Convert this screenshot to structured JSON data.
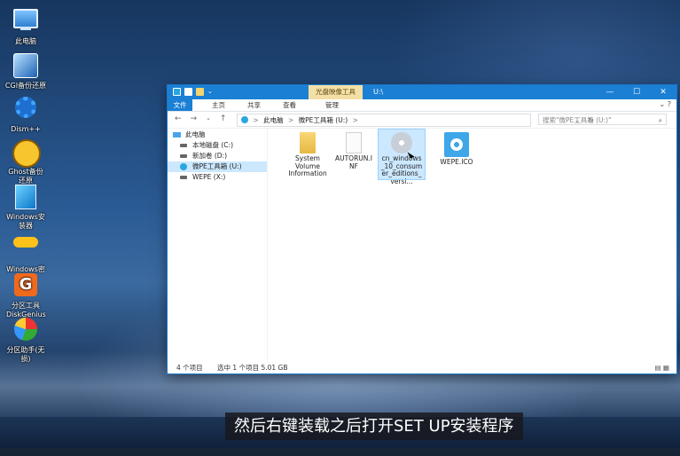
{
  "desktop": {
    "icons": [
      {
        "label": "此电脑",
        "icon": "computer-icon"
      },
      {
        "label": "CGI备份还原",
        "icon": "cgi-backup-icon"
      },
      {
        "label": "Dism++",
        "icon": "gear-icon"
      },
      {
        "label": "Ghost备份还原",
        "icon": "ghost-icon"
      },
      {
        "label": "Windows安装器",
        "icon": "windows-installer-icon"
      },
      {
        "label": "Windows密码修改",
        "icon": "key-icon"
      },
      {
        "label": "分区工具DiskGenius",
        "icon": "diskgenius-icon"
      },
      {
        "label": "分区助手(无损)",
        "icon": "partition-assistant-icon"
      }
    ]
  },
  "window": {
    "context_tab": "光盘映像工具",
    "title": "U:\\",
    "controls": {
      "minimize": "—",
      "maximize": "☐",
      "close": "✕"
    },
    "ribbon_tabs": [
      "文件",
      "主页",
      "共享",
      "查看",
      "管理"
    ],
    "address": {
      "back": "←",
      "forward": "→",
      "recent": "⌄",
      "up": "↑",
      "path": [
        "此电脑",
        "微PE工具箱 (U:)"
      ],
      "separator": ">",
      "dropdown": "⌄",
      "refresh": "↻"
    },
    "search_placeholder": "搜索\"微PE工具箱 (U:)\"",
    "nav_pane": [
      {
        "label": "此电脑",
        "icon": "computer-icon",
        "selected": false
      },
      {
        "label": "本地磁盘 (C:)",
        "icon": "drive-icon",
        "selected": false
      },
      {
        "label": "新加卷 (D:)",
        "icon": "drive-icon",
        "selected": false
      },
      {
        "label": "微PE工具箱 (U:)",
        "icon": "cd-drive-icon",
        "selected": true
      },
      {
        "label": "WEPE (X:)",
        "icon": "drive-icon",
        "selected": false
      }
    ],
    "files": [
      {
        "name": "System Volume Information",
        "icon": "folder-icon",
        "selected": false
      },
      {
        "name": "AUTORUN.INF",
        "icon": "document-icon",
        "selected": false
      },
      {
        "name": "cn_windows_10_consumer_editions_versi...",
        "icon": "disc-image-icon",
        "selected": true
      },
      {
        "name": "WEPE.ICO",
        "icon": "ico-file-icon",
        "selected": false
      }
    ],
    "status": {
      "count": "4 个项目",
      "selection": "选中 1 个项目 5.01 GB"
    }
  },
  "subtitle": "然后右键装载之后打开SET UP安装程序"
}
